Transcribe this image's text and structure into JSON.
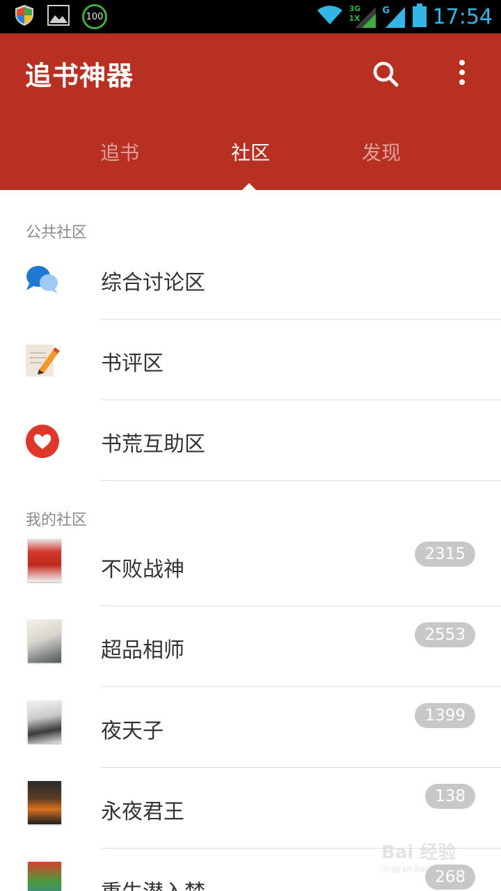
{
  "status_bar": {
    "battery_badge": "100",
    "network_3g": "3G",
    "network_1x": "1X",
    "network_g": "G",
    "time": "17:54"
  },
  "app_bar": {
    "title": "追书神器",
    "search_icon": "search-icon",
    "menu_icon": "more-vert-icon",
    "tabs": [
      {
        "label": "追书",
        "active": false
      },
      {
        "label": "社区",
        "active": true
      },
      {
        "label": "发现",
        "active": false
      }
    ]
  },
  "public_community": {
    "header": "公共社区",
    "items": [
      {
        "label": "综合讨论区",
        "icon": "chat-bubbles-icon"
      },
      {
        "label": "书评区",
        "icon": "note-pencil-icon"
      },
      {
        "label": "书荒互助区",
        "icon": "heart-icon"
      }
    ]
  },
  "my_community": {
    "header": "我的社区",
    "items": [
      {
        "label": "不败战神",
        "count": "2315"
      },
      {
        "label": "超品相师",
        "count": "2553"
      },
      {
        "label": "夜天子",
        "count": "1399"
      },
      {
        "label": "永夜君王",
        "count": "138"
      },
      {
        "label": "重生潜入梦",
        "count": "268"
      }
    ]
  },
  "watermark": {
    "main": "Bai 经验",
    "sub": "jingyan.baidu.com"
  },
  "colors": {
    "primary": "#b83022",
    "status_time": "#33b5e5",
    "count_badge": "#c8c8c8"
  }
}
